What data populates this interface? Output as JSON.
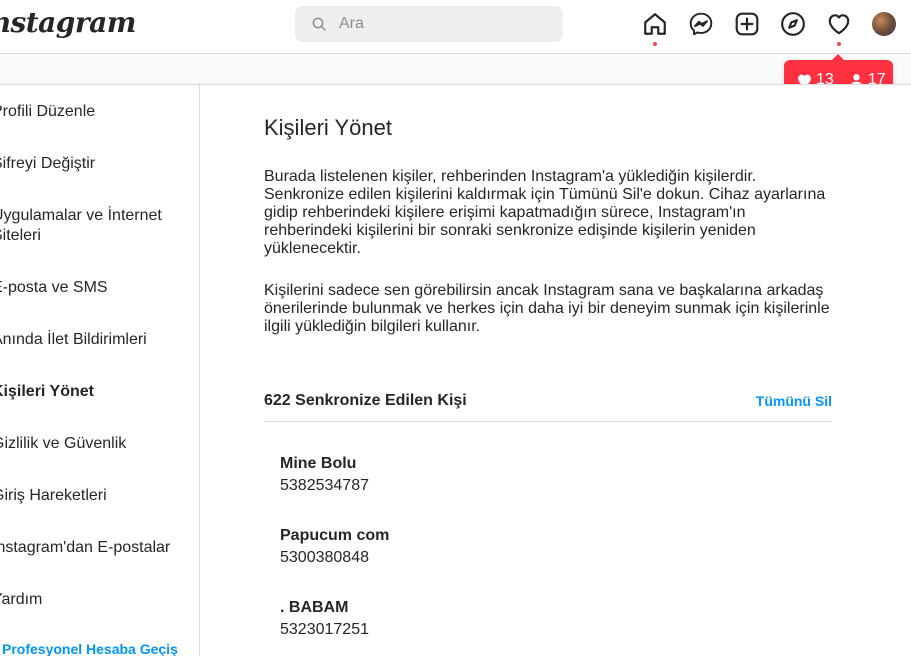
{
  "brand": {
    "logo_text": "Instagram"
  },
  "search": {
    "placeholder": "Ara"
  },
  "notifications": {
    "likes": "13",
    "followers": "17"
  },
  "sidebar": {
    "items": [
      {
        "label": "Profili Düzenle"
      },
      {
        "label": "Şifreyi Değiştir"
      },
      {
        "label": "Uygulamalar ve İnternet Siteleri"
      },
      {
        "label": "E-posta ve SMS"
      },
      {
        "label": "Anında İlet Bildirimleri"
      },
      {
        "label": "Kişileri Yönet"
      },
      {
        "label": "Gizlilik ve Güvenlik"
      },
      {
        "label": "Giriş Hareketleri"
      },
      {
        "label": "Instagram'dan E-postalar"
      },
      {
        "label": "Yardım"
      }
    ],
    "pro_link": "Profesyonel Hesaba Geçiş"
  },
  "main": {
    "title": "Kişileri Yönet",
    "paragraph1": "Burada listelenen kişiler, rehberinden Instagram'a yüklediğin kişilerdir. Senkronize edilen kişilerini kaldırmak için Tümünü Sil'e dokun. Cihaz ayarlarına gidip rehberindeki kişilere erişimi kapatmadığın sürece, Instagram'ın rehberindeki kişilerini bir sonraki senkronize edişinde kişilerin yeniden yüklenecektir.",
    "paragraph2": "Kişilerini sadece sen görebilirsin ancak Instagram sana ve başkalarına arkadaş önerilerinde bulunmak ve herkes için daha iyi bir deneyim sunmak için kişilerinle ilgili yüklediğin bilgileri kullanır.",
    "synced_count": "622 Senkronize Edilen Kişi",
    "delete_all": "Tümünü Sil",
    "contacts": [
      {
        "name": "Mine Bolu",
        "phone": "5382534787"
      },
      {
        "name": "Papucum com",
        "phone": "5300380848"
      },
      {
        "name": ". BABAM",
        "phone": "5323017251"
      }
    ]
  },
  "colors": {
    "accent": "#0095f6",
    "notification": "#ff3040",
    "border": "#dbdbdb"
  }
}
